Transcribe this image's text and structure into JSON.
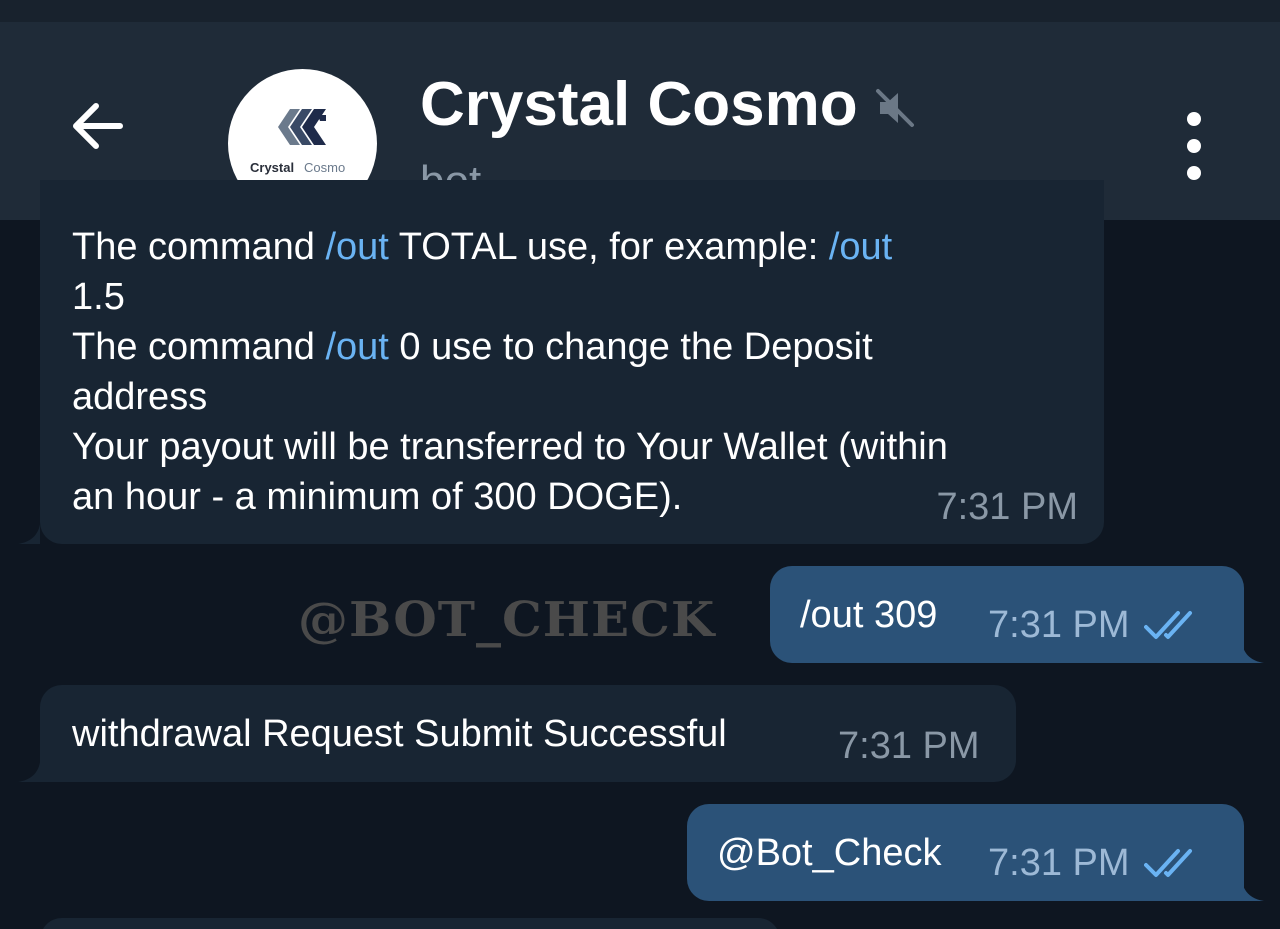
{
  "header": {
    "title": "Crystal Cosmo",
    "subtitle": "bot",
    "avatar_text_dark": "Crystal",
    "avatar_text_light": "Cosmo"
  },
  "messages": [
    {
      "direction": "incoming",
      "lines": [
        [
          "The command ",
          "/out",
          " TOTAL use, for example: ",
          "/out"
        ],
        [
          "1.5"
        ],
        [
          "The command ",
          "/out",
          " 0 use to change the Deposit"
        ],
        [
          "address"
        ],
        [
          "Your payout will be transferred to Your Wallet (within"
        ],
        [
          "an hour - a minimum of 300 DOGE)."
        ]
      ],
      "time": "7:31 PM"
    },
    {
      "direction": "outgoing",
      "command": "/out",
      "text": " 309",
      "time": "7:31 PM",
      "status": "read"
    },
    {
      "direction": "incoming",
      "text": "withdrawal Request Submit Successful",
      "time": "7:31 PM"
    },
    {
      "direction": "outgoing",
      "text": "@Bot_Check",
      "time": "7:31 PM",
      "status": "read"
    }
  ],
  "watermark": "@BOT_CHECK",
  "icons": {
    "back": "arrow-left-icon",
    "mute": "muted-speaker-icon",
    "menu": "more-vertical-icon",
    "read": "double-check-icon"
  },
  "colors": {
    "background": "#0e1621",
    "header": "#1f2b38",
    "incoming_bubble": "#182533",
    "outgoing_bubble": "#2b5278",
    "link": "#6ab3f3",
    "muted_text": "#8a98a6"
  }
}
